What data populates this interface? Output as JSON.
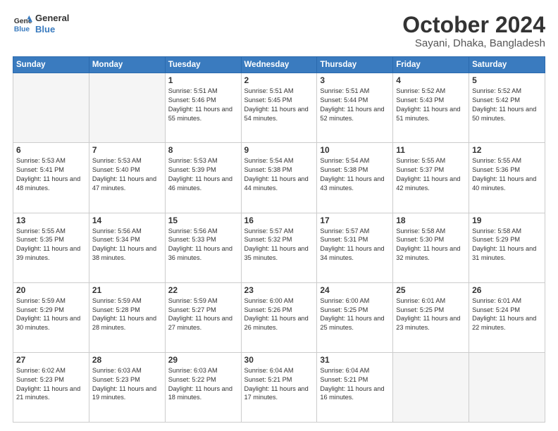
{
  "header": {
    "logo_line1": "General",
    "logo_line2": "Blue",
    "title": "October 2024",
    "subtitle": "Sayani, Dhaka, Bangladesh"
  },
  "days_of_week": [
    "Sunday",
    "Monday",
    "Tuesday",
    "Wednesday",
    "Thursday",
    "Friday",
    "Saturday"
  ],
  "weeks": [
    [
      {
        "day": "",
        "info": ""
      },
      {
        "day": "",
        "info": ""
      },
      {
        "day": "1",
        "info": "Sunrise: 5:51 AM\nSunset: 5:46 PM\nDaylight: 11 hours and 55 minutes."
      },
      {
        "day": "2",
        "info": "Sunrise: 5:51 AM\nSunset: 5:45 PM\nDaylight: 11 hours and 54 minutes."
      },
      {
        "day": "3",
        "info": "Sunrise: 5:51 AM\nSunset: 5:44 PM\nDaylight: 11 hours and 52 minutes."
      },
      {
        "day": "4",
        "info": "Sunrise: 5:52 AM\nSunset: 5:43 PM\nDaylight: 11 hours and 51 minutes."
      },
      {
        "day": "5",
        "info": "Sunrise: 5:52 AM\nSunset: 5:42 PM\nDaylight: 11 hours and 50 minutes."
      }
    ],
    [
      {
        "day": "6",
        "info": "Sunrise: 5:53 AM\nSunset: 5:41 PM\nDaylight: 11 hours and 48 minutes."
      },
      {
        "day": "7",
        "info": "Sunrise: 5:53 AM\nSunset: 5:40 PM\nDaylight: 11 hours and 47 minutes."
      },
      {
        "day": "8",
        "info": "Sunrise: 5:53 AM\nSunset: 5:39 PM\nDaylight: 11 hours and 46 minutes."
      },
      {
        "day": "9",
        "info": "Sunrise: 5:54 AM\nSunset: 5:38 PM\nDaylight: 11 hours and 44 minutes."
      },
      {
        "day": "10",
        "info": "Sunrise: 5:54 AM\nSunset: 5:38 PM\nDaylight: 11 hours and 43 minutes."
      },
      {
        "day": "11",
        "info": "Sunrise: 5:55 AM\nSunset: 5:37 PM\nDaylight: 11 hours and 42 minutes."
      },
      {
        "day": "12",
        "info": "Sunrise: 5:55 AM\nSunset: 5:36 PM\nDaylight: 11 hours and 40 minutes."
      }
    ],
    [
      {
        "day": "13",
        "info": "Sunrise: 5:55 AM\nSunset: 5:35 PM\nDaylight: 11 hours and 39 minutes."
      },
      {
        "day": "14",
        "info": "Sunrise: 5:56 AM\nSunset: 5:34 PM\nDaylight: 11 hours and 38 minutes."
      },
      {
        "day": "15",
        "info": "Sunrise: 5:56 AM\nSunset: 5:33 PM\nDaylight: 11 hours and 36 minutes."
      },
      {
        "day": "16",
        "info": "Sunrise: 5:57 AM\nSunset: 5:32 PM\nDaylight: 11 hours and 35 minutes."
      },
      {
        "day": "17",
        "info": "Sunrise: 5:57 AM\nSunset: 5:31 PM\nDaylight: 11 hours and 34 minutes."
      },
      {
        "day": "18",
        "info": "Sunrise: 5:58 AM\nSunset: 5:30 PM\nDaylight: 11 hours and 32 minutes."
      },
      {
        "day": "19",
        "info": "Sunrise: 5:58 AM\nSunset: 5:29 PM\nDaylight: 11 hours and 31 minutes."
      }
    ],
    [
      {
        "day": "20",
        "info": "Sunrise: 5:59 AM\nSunset: 5:29 PM\nDaylight: 11 hours and 30 minutes."
      },
      {
        "day": "21",
        "info": "Sunrise: 5:59 AM\nSunset: 5:28 PM\nDaylight: 11 hours and 28 minutes."
      },
      {
        "day": "22",
        "info": "Sunrise: 5:59 AM\nSunset: 5:27 PM\nDaylight: 11 hours and 27 minutes."
      },
      {
        "day": "23",
        "info": "Sunrise: 6:00 AM\nSunset: 5:26 PM\nDaylight: 11 hours and 26 minutes."
      },
      {
        "day": "24",
        "info": "Sunrise: 6:00 AM\nSunset: 5:25 PM\nDaylight: 11 hours and 25 minutes."
      },
      {
        "day": "25",
        "info": "Sunrise: 6:01 AM\nSunset: 5:25 PM\nDaylight: 11 hours and 23 minutes."
      },
      {
        "day": "26",
        "info": "Sunrise: 6:01 AM\nSunset: 5:24 PM\nDaylight: 11 hours and 22 minutes."
      }
    ],
    [
      {
        "day": "27",
        "info": "Sunrise: 6:02 AM\nSunset: 5:23 PM\nDaylight: 11 hours and 21 minutes."
      },
      {
        "day": "28",
        "info": "Sunrise: 6:03 AM\nSunset: 5:23 PM\nDaylight: 11 hours and 19 minutes."
      },
      {
        "day": "29",
        "info": "Sunrise: 6:03 AM\nSunset: 5:22 PM\nDaylight: 11 hours and 18 minutes."
      },
      {
        "day": "30",
        "info": "Sunrise: 6:04 AM\nSunset: 5:21 PM\nDaylight: 11 hours and 17 minutes."
      },
      {
        "day": "31",
        "info": "Sunrise: 6:04 AM\nSunset: 5:21 PM\nDaylight: 11 hours and 16 minutes."
      },
      {
        "day": "",
        "info": ""
      },
      {
        "day": "",
        "info": ""
      }
    ]
  ]
}
